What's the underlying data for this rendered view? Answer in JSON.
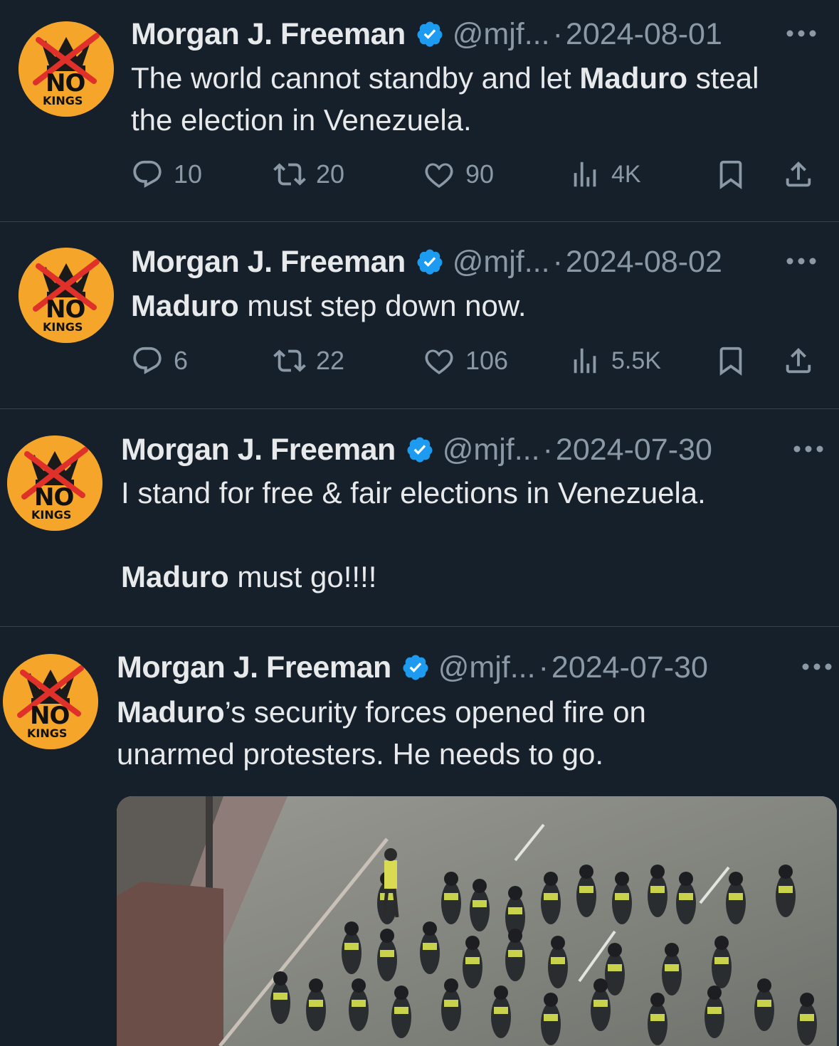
{
  "colors": {
    "background": "#15202b",
    "text": "#e7e9ea",
    "muted": "#8b98a5",
    "verified": "#1d9bf0",
    "avatar": "#f4a52a",
    "divider": "#38444d"
  },
  "avatar": {
    "word1": "NO",
    "word2": "KINGS"
  },
  "tweets": [
    {
      "name": "Morgan J. Freeman",
      "handle": "@mjf...",
      "sep": "·",
      "date": "2024-08-01",
      "text": [
        {
          "t": "The world cannot standby and let ",
          "b": false
        },
        {
          "t": "Maduro",
          "b": true
        },
        {
          "t": " steal\nthe election in Venezuela.",
          "b": false
        }
      ],
      "replies": "10",
      "reposts": "20",
      "likes": "90",
      "views": "4K"
    },
    {
      "name": "Morgan J. Freeman",
      "handle": "@mjf...",
      "sep": "·",
      "date": "2024-08-02",
      "text": [
        {
          "t": "Maduro",
          "b": true
        },
        {
          "t": " must step down now.",
          "b": false
        }
      ],
      "replies": "6",
      "reposts": "22",
      "likes": "106",
      "views": "5.5K"
    },
    {
      "name": "Morgan J. Freeman",
      "handle": "@mjf...",
      "sep": "·",
      "date": "2024-07-30",
      "text": [
        {
          "t": "I stand for free & fair elections in Venezuela.\n\n",
          "b": false
        },
        {
          "t": "Maduro",
          "b": true
        },
        {
          "t": " must go!!!!",
          "b": false
        }
      ]
    },
    {
      "name": "Morgan J. Freeman",
      "handle": "@mjf...",
      "sep": "·",
      "date": "2024-07-30",
      "text": [
        {
          "t": "Maduro",
          "b": true
        },
        {
          "t": "’s security forces opened fire on\nunarmed protesters. He needs to go.",
          "b": false
        }
      ],
      "media": {
        "icon": "video-thumbnail-image"
      }
    }
  ],
  "icons": [
    "verified-badge-icon",
    "more-icon",
    "reply-icon",
    "repost-icon",
    "like-icon",
    "views-icon",
    "bookmark-icon",
    "share-icon",
    "no-kings-crown-logo"
  ]
}
